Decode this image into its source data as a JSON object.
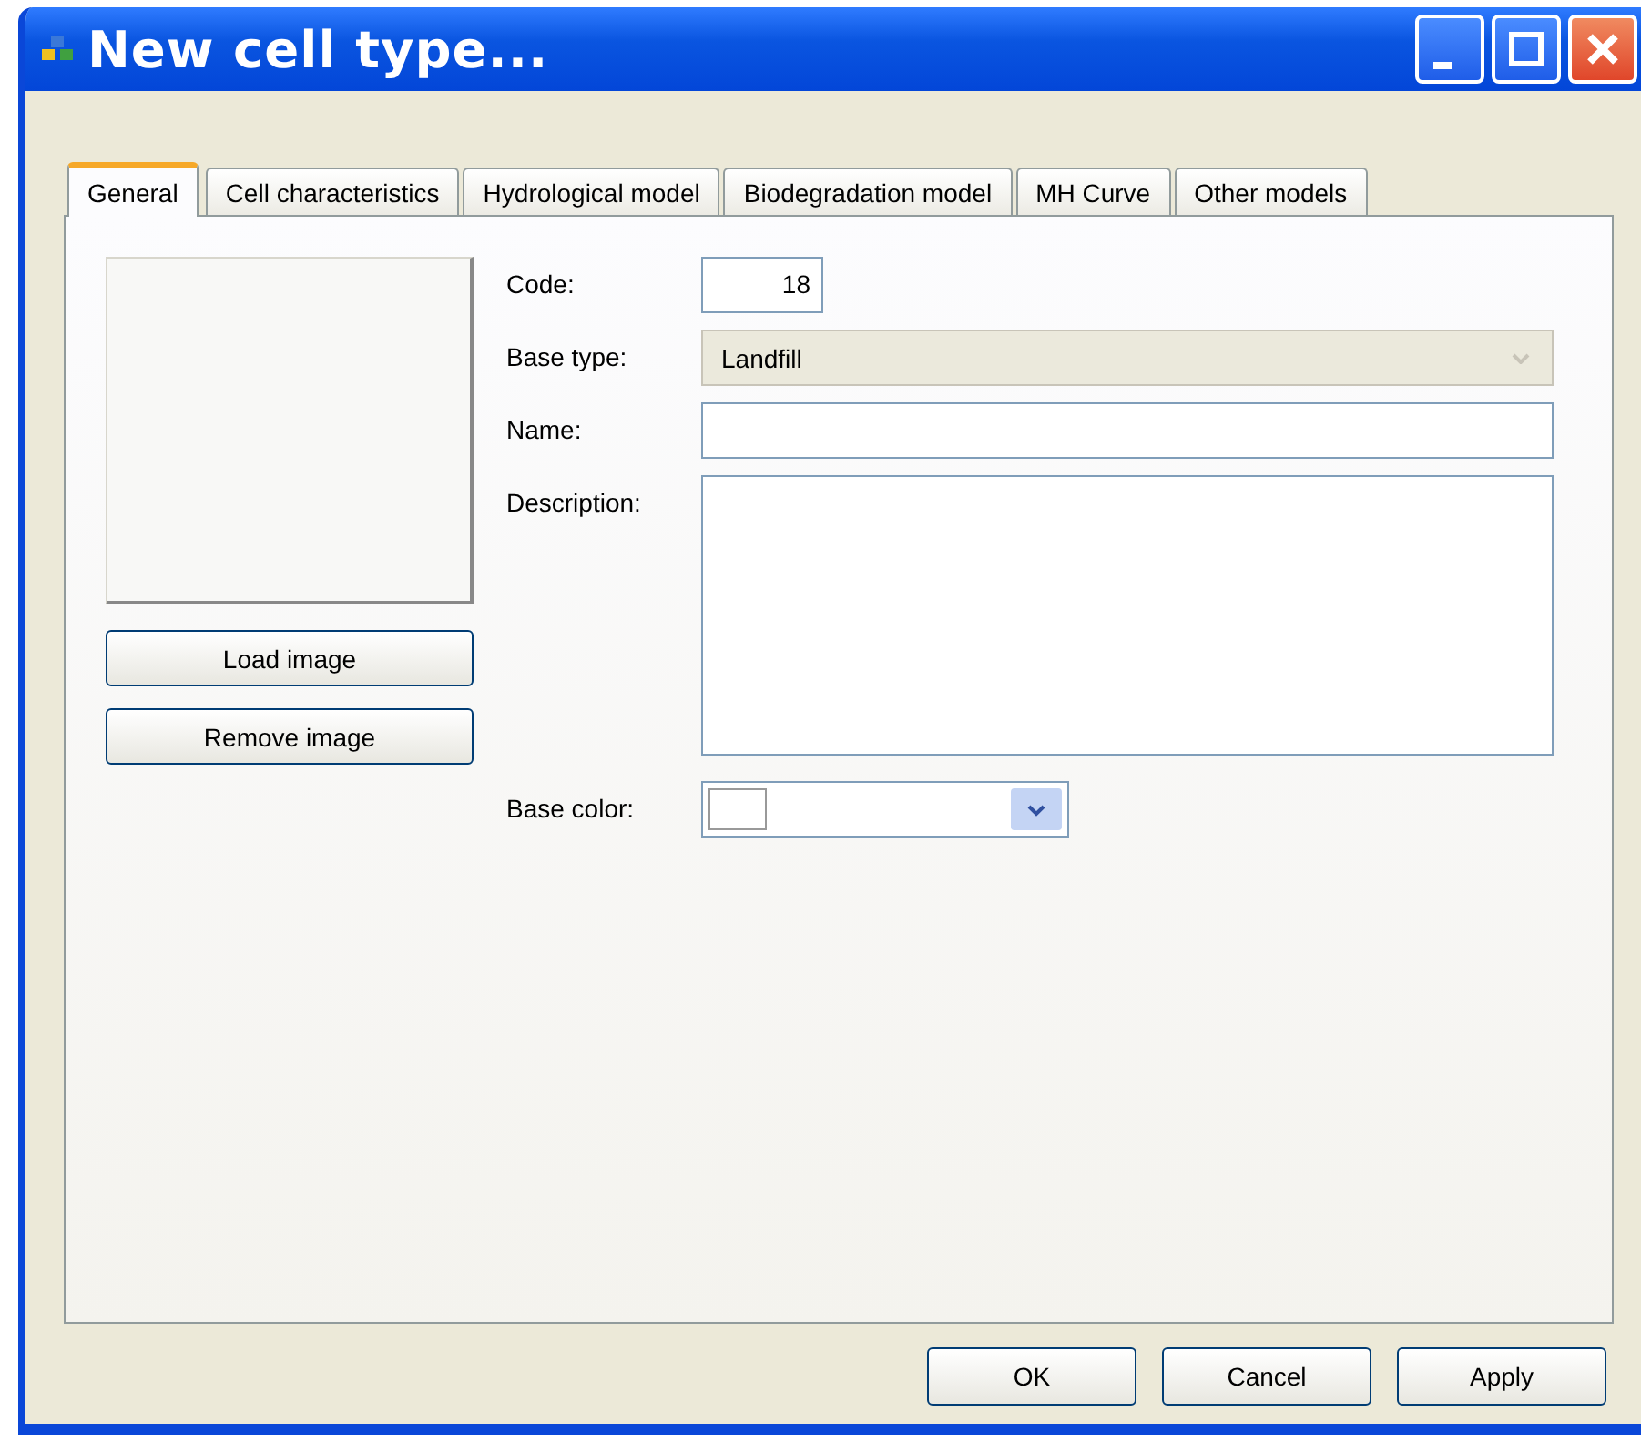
{
  "window": {
    "title": "New cell type..."
  },
  "tabs": [
    {
      "label": "General",
      "selected": true
    },
    {
      "label": "Cell characteristics",
      "selected": false
    },
    {
      "label": "Hydrological model",
      "selected": false
    },
    {
      "label": "Biodegradation model",
      "selected": false
    },
    {
      "label": "MH Curve",
      "selected": false
    },
    {
      "label": "Other models",
      "selected": false
    }
  ],
  "image_buttons": [
    "Load image",
    "Remove image"
  ],
  "fields": [
    {
      "kind": "number",
      "label": "Code:",
      "value": "18"
    },
    {
      "kind": "combo",
      "label": "Base type:",
      "value": "Landfill",
      "disabled": true
    },
    {
      "kind": "text",
      "label": "Name:"
    },
    {
      "kind": "memo",
      "label": "Description:"
    },
    {
      "kind": "color",
      "label": "Base color:"
    }
  ],
  "buttons": [
    "OK",
    "Cancel",
    "Apply"
  ]
}
